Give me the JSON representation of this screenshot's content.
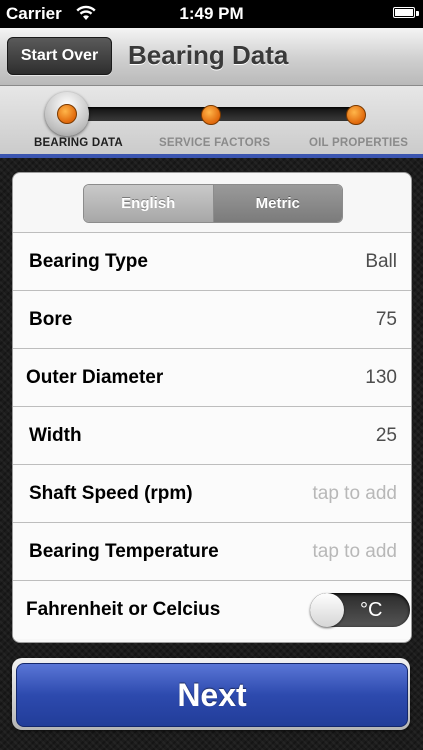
{
  "status_bar": {
    "carrier": "Carrier",
    "time": "1:49 PM"
  },
  "navbar": {
    "start_over_label": "Start Over",
    "title": "Bearing Data"
  },
  "steps": {
    "items": [
      {
        "label": "BEARING DATA",
        "active": true
      },
      {
        "label": "SERVICE FACTORS",
        "active": false
      },
      {
        "label": "OIL PROPERTIES",
        "active": false
      }
    ]
  },
  "units": {
    "options": [
      "English",
      "Metric"
    ],
    "selected": "Metric"
  },
  "rows": [
    {
      "label": "Bearing Type",
      "value": "Ball"
    },
    {
      "label": "Bore",
      "value": "75"
    },
    {
      "label": "Outer Diameter",
      "value": "130"
    },
    {
      "label": "Width",
      "value": "25"
    },
    {
      "label": "Shaft Speed (rpm)",
      "placeholder": "tap to add"
    },
    {
      "label": "Bearing Temperature",
      "placeholder": "tap to add"
    },
    {
      "label": "Fahrenheit or Celcius",
      "toggle_value": "°C"
    }
  ],
  "next_label": "Next",
  "colors": {
    "accent": "#3b55b0",
    "step_dot": "#e0680c"
  }
}
